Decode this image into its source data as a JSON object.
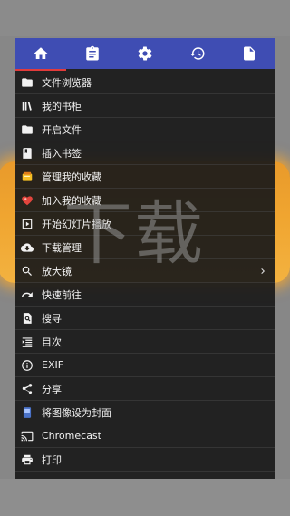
{
  "tabs": [
    {
      "name": "home"
    },
    {
      "name": "clipboard"
    },
    {
      "name": "settings"
    },
    {
      "name": "history"
    },
    {
      "name": "document"
    }
  ],
  "menu": [
    {
      "label": "文件浏览器",
      "icon": "folder-icon"
    },
    {
      "label": "我的书柜",
      "icon": "bookshelf-icon"
    },
    {
      "label": "开启文件",
      "icon": "folder-open-icon"
    },
    {
      "label": "插入书签",
      "icon": "bookmark-add-icon"
    },
    {
      "label": "管理我的收藏",
      "icon": "favorites-manage-icon"
    },
    {
      "label": "加入我的收藏",
      "icon": "favorite-heart-icon"
    },
    {
      "label": "开始幻灯片播放",
      "icon": "slideshow-play-icon"
    },
    {
      "label": "下载管理",
      "icon": "cloud-download-icon"
    },
    {
      "label": "放大镜",
      "icon": "magnifier-icon",
      "has_submenu": true
    },
    {
      "label": "快速前往",
      "icon": "redo-arrow-icon"
    },
    {
      "label": "搜寻",
      "icon": "search-doc-icon"
    },
    {
      "label": "目次",
      "icon": "table-of-contents-icon"
    },
    {
      "label": "EXIF",
      "icon": "info-icon"
    },
    {
      "label": "分享",
      "icon": "share-icon"
    },
    {
      "label": "将图像设为封面",
      "icon": "set-cover-icon"
    },
    {
      "label": "Chromecast",
      "icon": "cast-icon"
    },
    {
      "label": "打印",
      "icon": "print-icon"
    }
  ],
  "watermark": "下载",
  "colors": {
    "tabbar": "#3f4db3",
    "indicator": "#e23b3b",
    "banner": "#f0a530"
  }
}
